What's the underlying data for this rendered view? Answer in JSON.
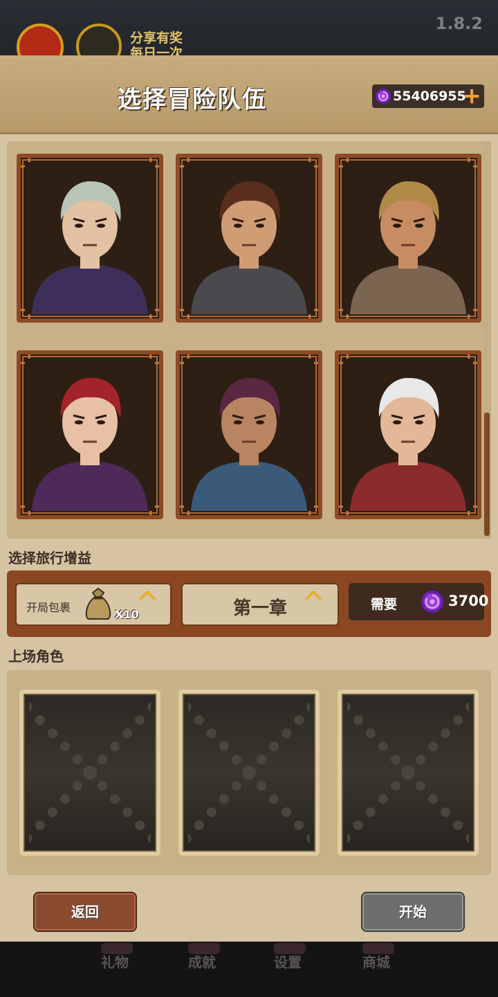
{
  "background": {
    "version": "1.8.2",
    "share_line1": "分享有奖",
    "share_line2": "每日一次",
    "nav": [
      {
        "label": "礼物",
        "icon": "gift-icon"
      },
      {
        "label": "成就",
        "icon": "trophy-icon"
      },
      {
        "label": "设置",
        "icon": "gear-icon"
      },
      {
        "label": "商城",
        "icon": "shop-icon"
      }
    ]
  },
  "header": {
    "title": "选择冒险队伍",
    "currency_amount": "55406955",
    "currency_icon": "purple-gem-icon",
    "add_icon": "plus-icon"
  },
  "roster": {
    "characters": [
      {
        "id": "necromancer",
        "icon": "portrait-necromancer",
        "hair": "#b9c4b6",
        "skin": "#e2c2a2",
        "cloth": "#3e2f5a"
      },
      {
        "id": "warrior",
        "icon": "portrait-warrior",
        "hair": "#5a2e1c",
        "skin": "#d09c74",
        "cloth": "#4a4a4e"
      },
      {
        "id": "ranger",
        "icon": "portrait-ranger",
        "hair": "#b08a48",
        "skin": "#c88c62",
        "cloth": "#7a6550"
      },
      {
        "id": "assassin",
        "icon": "portrait-assassin",
        "hair": "#a3232a",
        "skin": "#e7c0a6",
        "cloth": "#4e2a5a"
      },
      {
        "id": "shaman",
        "icon": "portrait-shaman",
        "hair": "#5a2840",
        "skin": "#b98462",
        "cloth": "#3b5a7a"
      },
      {
        "id": "mage",
        "icon": "portrait-mage",
        "hair": "#e8e8e8",
        "skin": "#e2b898",
        "cloth": "#8a2c2c"
      }
    ]
  },
  "boost": {
    "section_label": "选择旅行增益",
    "pack_label": "开局包裹",
    "pack_count": "X10",
    "pack_icon": "bag-icon",
    "chapter_label": "第一章",
    "cost_label": "需要",
    "cost_amount": "3700",
    "cost_icon": "purple-gem-icon"
  },
  "party": {
    "section_label": "上场角色",
    "slots": [
      "empty",
      "empty",
      "empty"
    ]
  },
  "buttons": {
    "back": "返回",
    "start": "开始"
  },
  "colors": {
    "panel": "#d6c3a2",
    "card_frame": "#8d4b25",
    "gem": "#9b3fd6",
    "back_button": "#8a4a2f",
    "start_button": "#6e6e6e"
  }
}
